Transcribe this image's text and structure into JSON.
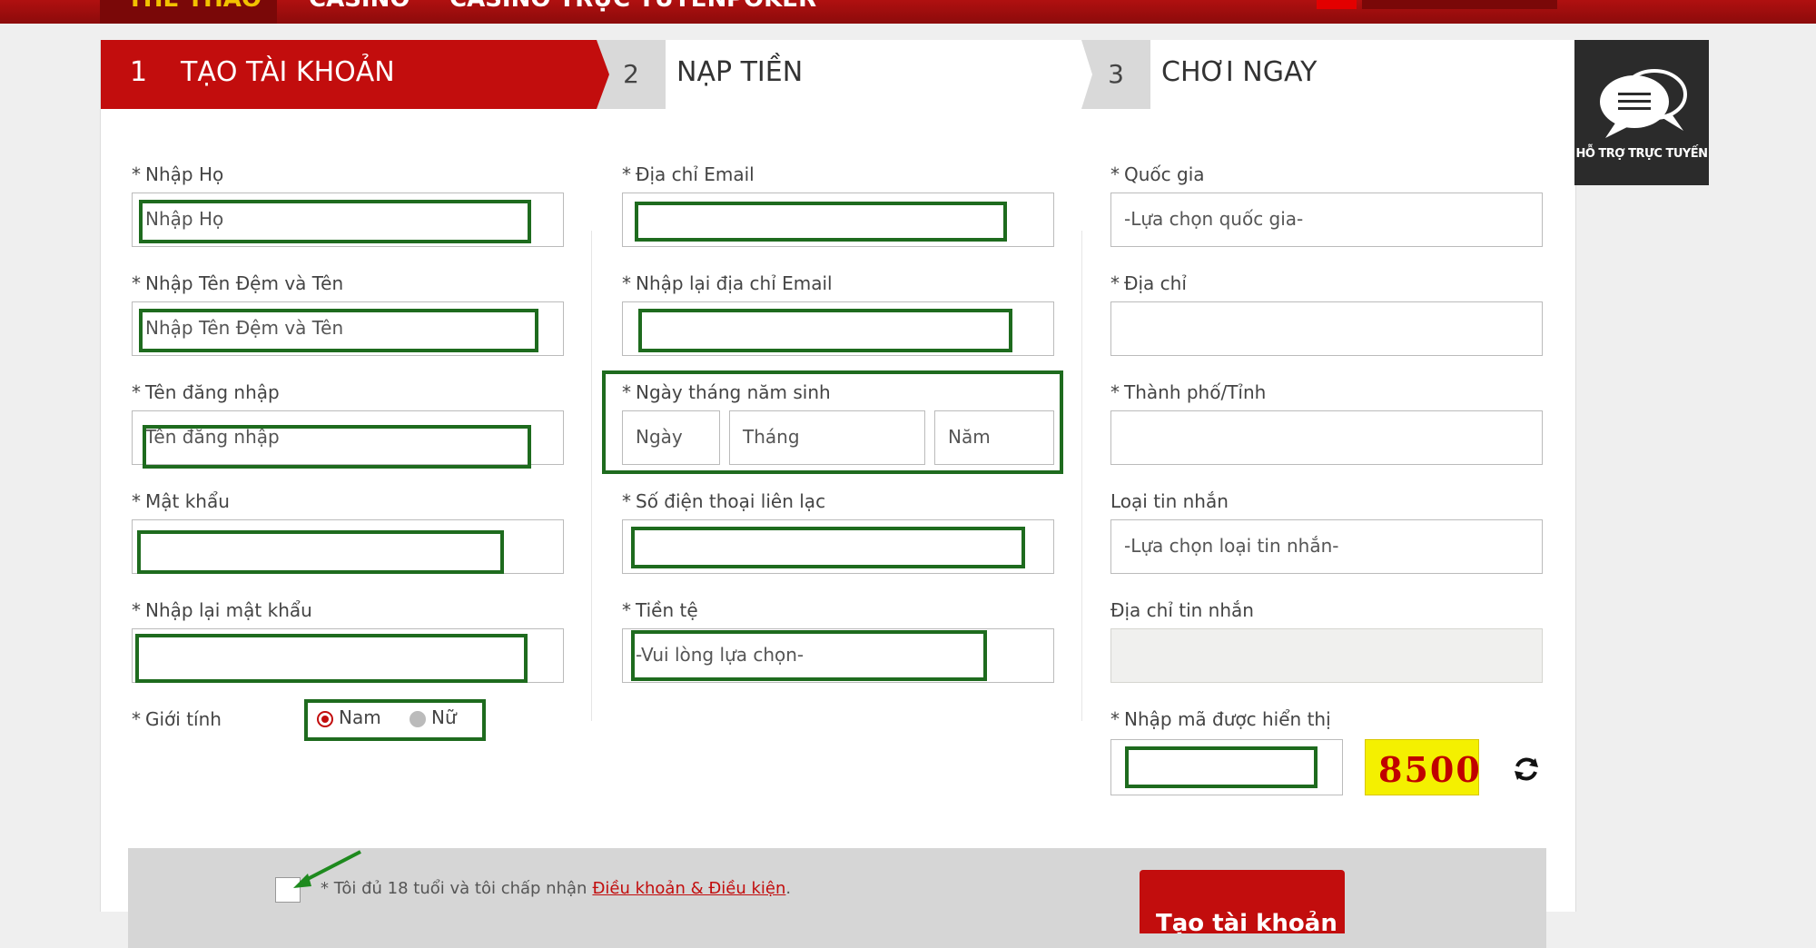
{
  "topnav": {
    "items": [
      "THỂ THAO",
      "CASINO",
      "CASINO TRỰC TUYẾN",
      "POKER"
    ],
    "active_color": "#f2c200",
    "bar_color": "#a00d0d"
  },
  "steps": [
    {
      "number": "1",
      "label": "TẠO TÀI KHOẢN",
      "active": true
    },
    {
      "number": "2",
      "label": "NẠP TIỀN",
      "active": false
    },
    {
      "number": "3",
      "label": "CHƠI NGAY",
      "active": false
    }
  ],
  "form": {
    "last_name": {
      "label": "Nhập Họ",
      "placeholder": "Nhập Họ",
      "required": true
    },
    "first_name": {
      "label": "Nhập Tên Đệm và Tên",
      "placeholder": "Nhập Tên Đệm và Tên",
      "required": true
    },
    "username": {
      "label": "Tên đăng nhập",
      "placeholder": "Tên đăng nhập",
      "required": true
    },
    "password": {
      "label": "Mật khẩu",
      "placeholder": "",
      "required": true
    },
    "password_confirm": {
      "label": "Nhập lại mật khẩu",
      "placeholder": "",
      "required": true
    },
    "gender": {
      "label": "Giới tính",
      "options": [
        "Nam",
        "Nữ"
      ],
      "selected": "Nam",
      "required": true
    },
    "email": {
      "label": "Địa chỉ Email",
      "placeholder": "",
      "required": true
    },
    "email_confirm": {
      "label": "Nhập lại địa chỉ Email",
      "placeholder": "",
      "required": true
    },
    "dob": {
      "label": "Ngày tháng năm sinh",
      "day": "Ngày",
      "month": "Tháng",
      "year": "Năm",
      "required": true
    },
    "phone": {
      "label": "Số điện thoại liên lạc",
      "placeholder": "",
      "required": true
    },
    "currency": {
      "label": "Tiền tệ",
      "value": "-Vui lòng lựa chọn-",
      "required": true
    },
    "country": {
      "label": "Quốc gia",
      "value": "-Lựa chọn quốc gia-",
      "required": true
    },
    "address": {
      "label": "Địa chỉ",
      "placeholder": "",
      "required": true
    },
    "city": {
      "label": "Thành phố/Tỉnh",
      "placeholder": "",
      "required": true
    },
    "message_type": {
      "label": "Loại tin nhắn",
      "value": "-Lựa chọn loại tin nhắn-",
      "required": false
    },
    "message_address": {
      "label": "Địa chỉ tin nhắn",
      "placeholder": "",
      "required": false
    },
    "captcha": {
      "label": "Nhập mã được hiển thị",
      "code": "8500",
      "required": true
    }
  },
  "agreement": {
    "text": "Tôi đủ 18 tuổi và tôi chấp nhận",
    "link": "Điều khoản & Điều kiện",
    "suffix": "."
  },
  "submit": {
    "label": "Tạo tài khoản"
  },
  "support": {
    "label": "HỖ TRỢ TRỰC TUYẾN",
    "icon": "chat-bubbles-icon"
  },
  "colors": {
    "brand_red": "#c20d0d",
    "highlight_green": "#1e6b1e",
    "captcha_bg": "#f4f000"
  }
}
